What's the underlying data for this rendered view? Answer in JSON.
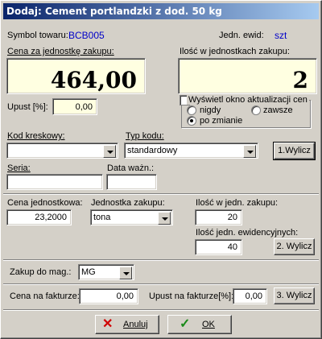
{
  "window": {
    "title": "Dodaj: Cement portlandzki z dod. 50 kg"
  },
  "header": {
    "symbol_label": "Symbol towaru:",
    "symbol_value": "BCB005",
    "unit_label": "Jedn. ewid:",
    "unit_value": "szt"
  },
  "purchase": {
    "price_label": "Cena za jednostkę zakupu:",
    "price_value": "464,00",
    "qty_label": "Ilość w jednostkach zakupu:",
    "qty_value": "2"
  },
  "discount": {
    "label": "Upust [%]:",
    "value": "0,00"
  },
  "update_window": {
    "label": "Wyświetl okno aktualizacji cen",
    "options": [
      {
        "label": "nigdy",
        "selected": false
      },
      {
        "label": "zawsze",
        "selected": false
      },
      {
        "label": "po zmianie",
        "selected": true
      }
    ]
  },
  "barcode": {
    "label": "Kod kreskowy:",
    "value": "",
    "type_label": "Typ kodu:",
    "type_value": "standardowy",
    "calc_button": "1.Wylicz"
  },
  "series": {
    "label": "Seria:",
    "value": "",
    "expiry_label": "Data ważn.:",
    "expiry_value": ""
  },
  "unit_price": {
    "price_label": "Cena jednostkowa:",
    "price_value": "23,2000",
    "unit_label": "Jednostka zakupu:",
    "unit_value": "tona",
    "qty_purchase_label": "Ilość w jedn. zakupu:",
    "qty_purchase_value": "20",
    "qty_ewid_label": "Ilość jedn. ewidencyjnych:",
    "qty_ewid_value": "40",
    "calc_button": "2. Wylicz"
  },
  "warehouse": {
    "label": "Zakup do mag.:",
    "value": "MG"
  },
  "invoice": {
    "price_label": "Cena na fakturze:",
    "price_value": "0,00",
    "discount_label": "Upust na fakturze[%]:",
    "discount_value": "0,00",
    "calc_button": "3. Wylicz"
  },
  "footer": {
    "cancel_label": "Anuluj",
    "ok_label": "OK"
  }
}
